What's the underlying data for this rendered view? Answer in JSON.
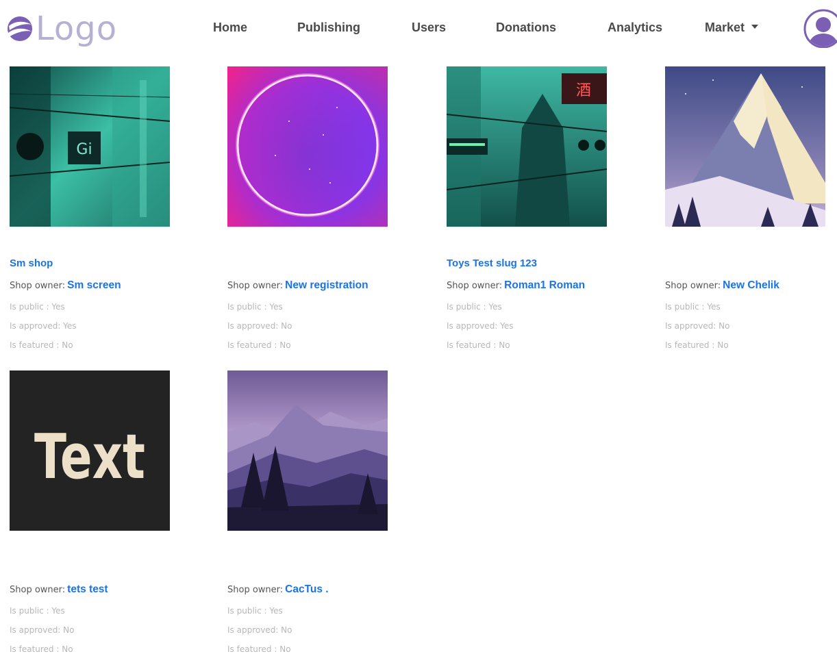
{
  "brand": {
    "logo_text": "Logo",
    "accent": "#1a73e8",
    "purple": "#7b5fb5"
  },
  "nav": {
    "items": [
      {
        "label": "Home"
      },
      {
        "label": "Publishing"
      },
      {
        "label": "Users"
      },
      {
        "label": "Donations"
      },
      {
        "label": "Analytics"
      },
      {
        "label": "Market"
      }
    ],
    "avatar_icon": "user-avatar-icon"
  },
  "shops": [
    {
      "name": "Sm shop",
      "image": "cyberpunk-street",
      "owner_label": "Shop owner:",
      "owner": "Sm screen",
      "is_public": "Is public : Yes",
      "is_approved": "Is approved: Yes",
      "is_featured": "Is featured : No"
    },
    {
      "name": "",
      "image": "neon-circle",
      "owner_label": "Shop owner:",
      "owner": "New registration",
      "is_public": "Is public : Yes",
      "is_approved": "Is approved: No",
      "is_featured": "Is featured : No"
    },
    {
      "name": "Toys Test slug 123",
      "image": "cyberpunk-city",
      "owner_label": "Shop owner:",
      "owner": "Roman1 Roman",
      "is_public": "Is public : Yes",
      "is_approved": "Is approved: Yes",
      "is_featured": "Is featured : No"
    },
    {
      "name": "",
      "image": "snowy-mountain",
      "owner_label": "Shop owner:",
      "owner": "New Chelik",
      "is_public": "Is public : Yes",
      "is_approved": "Is approved: No",
      "is_featured": "Is featured : No"
    },
    {
      "name": "",
      "image": "text-placeholder",
      "image_text": "Text",
      "owner_label": "Shop owner:",
      "owner": "tets test",
      "is_public": "Is public : Yes",
      "is_approved": "Is approved: No",
      "is_featured": "Is featured : No"
    },
    {
      "name": "",
      "image": "purple-mountains",
      "owner_label": "Shop owner:",
      "owner": "CacTus .",
      "is_public": "Is public : Yes",
      "is_approved": "Is approved: No",
      "is_featured": "Is featured : No"
    }
  ]
}
